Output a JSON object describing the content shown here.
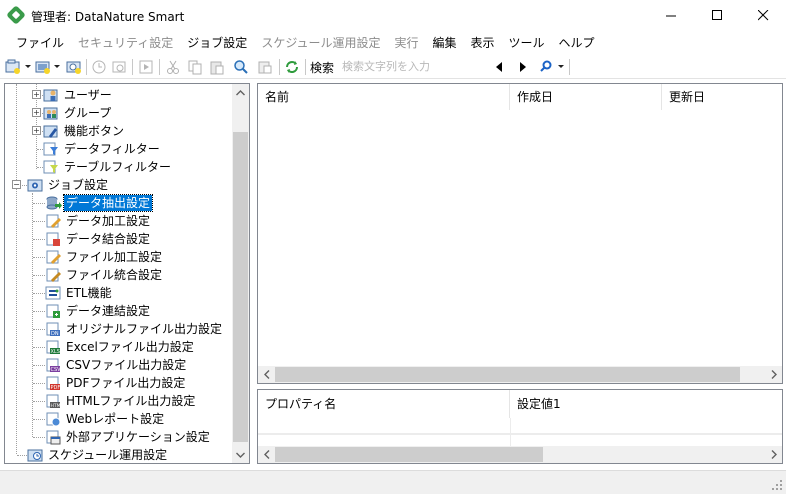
{
  "window": {
    "title": "管理者: DataNature Smart"
  },
  "menu": [
    {
      "label": "ファイル",
      "enabled": true
    },
    {
      "label": "セキュリティ設定",
      "enabled": false
    },
    {
      "label": "ジョブ設定",
      "enabled": true
    },
    {
      "label": "スケジュール運用設定",
      "enabled": false
    },
    {
      "label": "実行",
      "enabled": false
    },
    {
      "label": "編集",
      "enabled": true
    },
    {
      "label": "表示",
      "enabled": true
    },
    {
      "label": "ツール",
      "enabled": true
    },
    {
      "label": "ヘルプ",
      "enabled": true
    }
  ],
  "toolbar": {
    "search_label": "検索",
    "search_placeholder": "検索文字列を入力"
  },
  "tree": {
    "items": [
      {
        "label": "ユーザー",
        "icon": "user-icon",
        "expander": "+"
      },
      {
        "label": "グループ",
        "icon": "group-icon",
        "expander": "+"
      },
      {
        "label": "機能ボタン",
        "icon": "function-button-icon",
        "expander": "+"
      },
      {
        "label": "データフィルター",
        "icon": "data-filter-icon",
        "expander": ""
      },
      {
        "label": "テーブルフィルター",
        "icon": "table-filter-icon",
        "expander": ""
      },
      {
        "label": "ジョブ設定",
        "icon": "job-settings-icon",
        "expander": "−"
      },
      {
        "label": "データ抽出設定",
        "icon": "data-extract-icon",
        "selected": true
      },
      {
        "label": "データ加工設定",
        "icon": "data-process-icon"
      },
      {
        "label": "データ結合設定",
        "icon": "data-join-icon"
      },
      {
        "label": "ファイル加工設定",
        "icon": "file-process-icon"
      },
      {
        "label": "ファイル統合設定",
        "icon": "file-merge-icon"
      },
      {
        "label": "ETL機能",
        "icon": "etl-icon"
      },
      {
        "label": "データ連結設定",
        "icon": "data-concat-icon"
      },
      {
        "label": "オリジナルファイル出力設定",
        "icon": "original-file-output-icon"
      },
      {
        "label": "Excelファイル出力設定",
        "icon": "excel-output-icon"
      },
      {
        "label": "CSVファイル出力設定",
        "icon": "csv-output-icon"
      },
      {
        "label": "PDFファイル出力設定",
        "icon": "pdf-output-icon"
      },
      {
        "label": "HTMLファイル出力設定",
        "icon": "html-output-icon"
      },
      {
        "label": "Webレポート設定",
        "icon": "web-report-icon"
      },
      {
        "label": "外部アプリケーション設定",
        "icon": "external-app-icon"
      },
      {
        "label": "スケジュール運用設定",
        "icon": "schedule-icon"
      }
    ]
  },
  "list": {
    "columns": [
      "名前",
      "作成日",
      "更新日"
    ]
  },
  "properties": {
    "columns": [
      "プロパティ名",
      "設定値1"
    ]
  },
  "colors": {
    "selection": "#0078d7",
    "app_icon": "#3a9b4a"
  }
}
